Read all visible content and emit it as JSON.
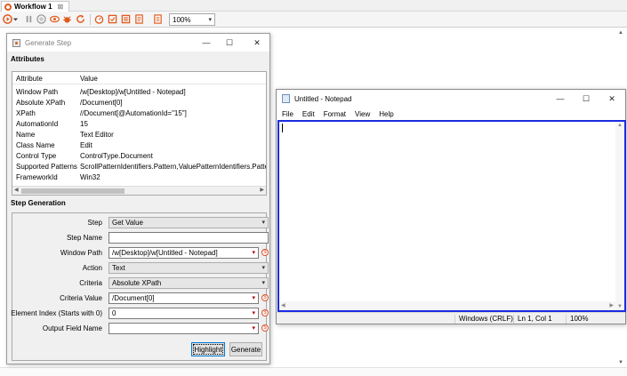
{
  "editor_tab": {
    "label": "Workflow 1",
    "close": "⊠"
  },
  "toolbar": {
    "zoom_value": "100%",
    "icons": [
      "run-dropdown-icon",
      "pause-icon",
      "stop-icon",
      "watch-icon",
      "debug-icon",
      "refresh-icon",
      "stopwatch-icon",
      "step-icon",
      "record-icon",
      "notes-icon",
      "properties-icon"
    ]
  },
  "dialog": {
    "title": "Generate Step",
    "controls": {
      "minimize": "—",
      "maximize": "☐",
      "close": "✕"
    },
    "attributes_heading": "Attributes",
    "attributes_table": {
      "headers": [
        "Attribute",
        "Value"
      ],
      "rows": [
        [
          "Window Path",
          "/w[Desktop]/w[Untitled - Notepad]"
        ],
        [
          "Absolute XPath",
          "/Document[0]"
        ],
        [
          "XPath",
          "//Document[@AutomationId=\"15\"]"
        ],
        [
          "AutomationId",
          "15"
        ],
        [
          "Name",
          "Text Editor"
        ],
        [
          "Class Name",
          "Edit"
        ],
        [
          "Control Type",
          "ControlType.Document"
        ],
        [
          "Supported Patterns",
          "ScrollPatternIdentifiers.Pattern,ValuePatternIdentifiers.Pattern"
        ],
        [
          "FrameworkId",
          "Win32"
        ]
      ]
    },
    "step_generation_heading": "Step Generation",
    "form": {
      "step": {
        "label": "Step",
        "value": "Get Value"
      },
      "step_name": {
        "label": "Step Name",
        "value": ""
      },
      "window_path": {
        "label": "Window Path",
        "value": "/w[Desktop]/w[Untitled - Notepad]"
      },
      "action": {
        "label": "Action",
        "value": "Text"
      },
      "criteria": {
        "label": "Criteria",
        "value": "Absolute XPath"
      },
      "criteria_value": {
        "label": "Criteria Value",
        "value": "/Document[0]"
      },
      "element_index": {
        "label": "Element Index (Starts with 0)",
        "value": "0"
      },
      "output_field_name": {
        "label": "Output Field Name",
        "value": ""
      },
      "variable_symbol": "$"
    },
    "buttons": {
      "highlight": "Highlight",
      "generate": "Generate"
    }
  },
  "notepad": {
    "title": "Untitled - Notepad",
    "controls": {
      "minimize": "—",
      "maximize": "☐",
      "close": "✕"
    },
    "menu": [
      "File",
      "Edit",
      "Format",
      "View",
      "Help"
    ],
    "status": {
      "line_ending": "Windows (CRLF)",
      "position": "Ln 1, Col 1",
      "zoom": "100%"
    }
  },
  "colors": {
    "accent_orange": "#e25a1c",
    "focus_blue": "#1a2be0",
    "dialog_bg": "#f0f0f0"
  }
}
